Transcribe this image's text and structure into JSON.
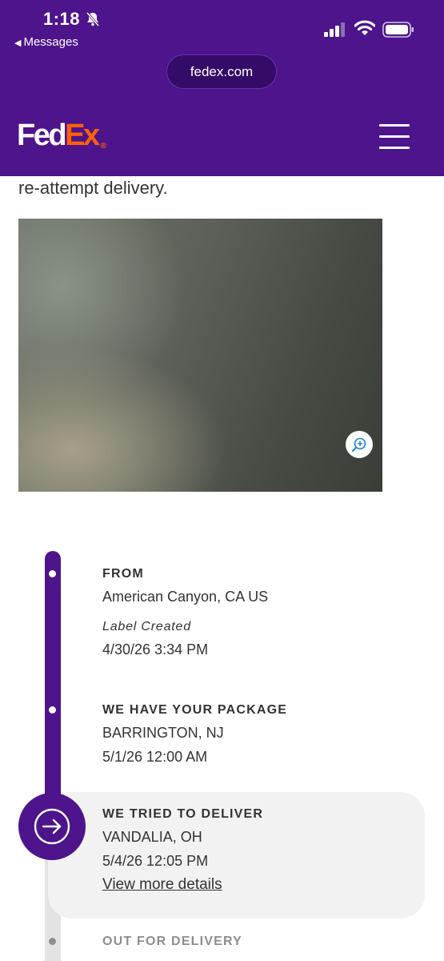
{
  "status_bar": {
    "time": "1:18",
    "back_label": "Messages",
    "icons": [
      "bell-slash-icon",
      "cellular-signal-icon",
      "wifi-icon",
      "battery-icon"
    ]
  },
  "browser": {
    "url": "fedex.com"
  },
  "header": {
    "logo_fed": "Fed",
    "logo_ex": "Ex",
    "logo_reg": "®",
    "menu_icon": "hamburger-menu-icon"
  },
  "content": {
    "intro_text": "re-attempt delivery.",
    "photo_zoom_icon": "zoom-in-icon"
  },
  "timeline": {
    "from": {
      "title": "FROM",
      "location": "American Canyon, CA US",
      "status": "Label Created",
      "datetime": "4/30/26 3:34 PM"
    },
    "have_package": {
      "title": "WE HAVE YOUR PACKAGE",
      "location": "BARRINGTON, NJ",
      "datetime": "5/1/26 12:00 AM"
    },
    "tried_deliver": {
      "title": "WE TRIED TO DELIVER",
      "location": "VANDALIA, OH",
      "datetime": "5/4/26 12:05 PM",
      "link": "View more details",
      "icon": "arrow-right-circle-icon"
    },
    "out_for_delivery": {
      "title": "OUT FOR DELIVERY"
    }
  },
  "colors": {
    "brand_purple": "#4d148c",
    "brand_orange": "#ff6200",
    "pending_grey": "#8e8e8e"
  }
}
